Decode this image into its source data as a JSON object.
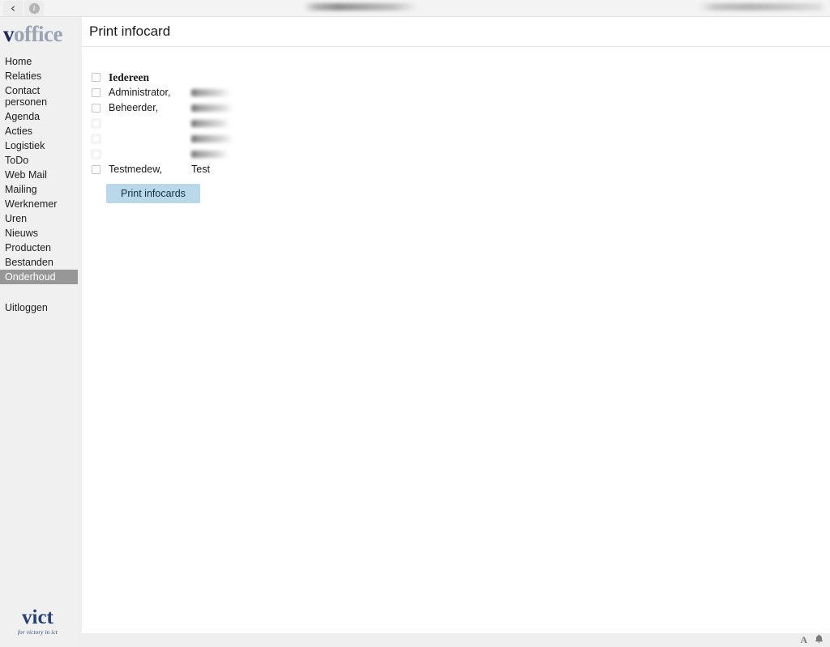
{
  "browser": {
    "back_icon": "chevron-left-icon",
    "info_icon": "info-icon",
    "info_glyph": "i",
    "back_glyph": "‹",
    "url_redacted": true,
    "meta_redacted": true
  },
  "sidebar": {
    "logo": {
      "part1": "v",
      "part2": "office",
      "full": "voffice"
    },
    "items": [
      {
        "label": "Home",
        "active": false
      },
      {
        "label": "Relaties",
        "active": false
      },
      {
        "label": "Contact\npersonen",
        "active": false
      },
      {
        "label": "Agenda",
        "active": false
      },
      {
        "label": "Acties",
        "active": false
      },
      {
        "label": "Logistiek",
        "active": false
      },
      {
        "label": "ToDo",
        "active": false
      },
      {
        "label": "Web Mail",
        "active": false
      },
      {
        "label": "Mailing",
        "active": false
      },
      {
        "label": "Werknemer",
        "active": false
      },
      {
        "label": "Uren",
        "active": false
      },
      {
        "label": "Nieuws",
        "active": false
      },
      {
        "label": "Producten",
        "active": false
      },
      {
        "label": "Bestanden",
        "active": false
      },
      {
        "label": "Onderhoud",
        "active": true
      }
    ],
    "logout": {
      "label": "Uitloggen"
    },
    "footer_logo": {
      "word": "vict",
      "tagline": "for victory in ict"
    }
  },
  "main": {
    "title": "Print infocard",
    "list": {
      "select_all": {
        "label": "Iedereen",
        "checked": false
      },
      "rows": [
        {
          "last_name": "Administrator,",
          "first_name": "",
          "checked": false,
          "redacted": false,
          "first_name_redacted": true
        },
        {
          "last_name": "Beheerder,",
          "first_name": "",
          "checked": false,
          "redacted": false,
          "first_name_redacted": true
        },
        {
          "last_name": "",
          "first_name": "",
          "checked": false,
          "redacted": true
        },
        {
          "last_name": "",
          "first_name": "",
          "checked": false,
          "redacted": true
        },
        {
          "last_name": "",
          "first_name": "",
          "checked": false,
          "redacted": true
        },
        {
          "last_name": "Testmedew,",
          "first_name": "Test",
          "checked": false,
          "redacted": false
        }
      ]
    },
    "print_button": {
      "label": "Print infocards"
    }
  },
  "footer": {
    "font_size_icon": "font-size-icon",
    "font_size_glyph": "A",
    "bell_icon": "bell-icon",
    "bell_glyph": "🔔"
  },
  "colors": {
    "sidebar_bg": "#f0f0f0",
    "active_nav": "#979797",
    "button_bg": "#b9d9ea",
    "brand_dark": "#1b2a52",
    "brand_gray": "#9aa3b4",
    "vict_blue": "#24407a",
    "page_bg": "#efefef"
  }
}
